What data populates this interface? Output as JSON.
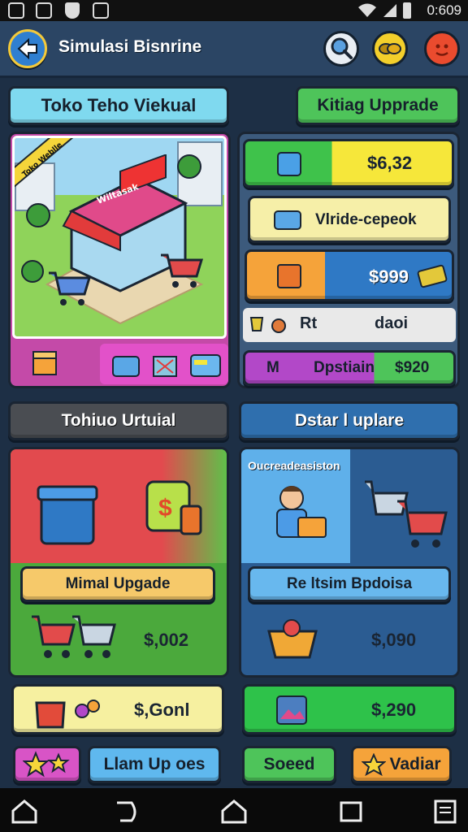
{
  "status_bar": {
    "time": "0:609",
    "icons": [
      "image-icon",
      "square-icon",
      "shield-icon",
      "photo-icon",
      "wifi-icon",
      "signal-icon",
      "battery-icon"
    ]
  },
  "header": {
    "title": "Simulasi Bisnrine",
    "buttons": [
      "search-icon",
      "coins-icon",
      "emoji-icon"
    ]
  },
  "top_tabs": {
    "left": "Toko Teho Viekual",
    "right": "Kitiag Upprade"
  },
  "store_panel": {
    "banner": "Toko Weblle",
    "shop_sign": "Wiltasak"
  },
  "stats": {
    "row1_value": "$6,32",
    "row2_label": "Vlride-cepeok",
    "row3_value": "$999",
    "row4_left": "Rt",
    "row4_right": "daoi",
    "row5_label": "M",
    "row5_text": "Dpstiain",
    "row5_value": "$920"
  },
  "section_tabs": {
    "left": "Tohiuo Urtuial",
    "right": "Dstar l uplare"
  },
  "left_card": {
    "button": "Mimal Upgade",
    "value": "$,002",
    "bottom_value": "$,Gonl"
  },
  "right_card": {
    "header": "Oucreadeasiston",
    "button": "Re ltsim Bpdoisa",
    "value": "$,090",
    "bottom_value": "$,290"
  },
  "action_bar": {
    "button1": "Llam Up oes",
    "button2": "Soeed",
    "button3": "Vadiar"
  },
  "colors": {
    "header_bg": "#2b4564",
    "page_bg": "#1d2f45",
    "accent_yellow": "#f6e73a",
    "accent_green": "#38c64a",
    "accent_blue": "#2f79c5",
    "accent_orange": "#f5a33a",
    "accent_purple": "#b248c8"
  }
}
